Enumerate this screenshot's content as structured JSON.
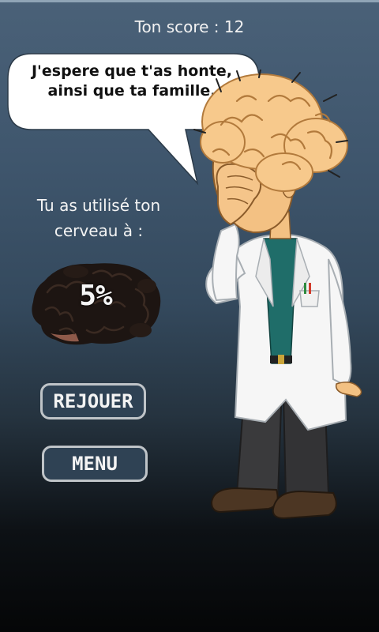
{
  "game": {
    "score_text": "Ton score : 12",
    "speech_line1": "J'espere que t'as honte,",
    "speech_line2": "ainsi que ta famille.",
    "usage_line1": "Tu as utilisé ton",
    "usage_line2": "cerveau à :",
    "brain_percent": "5%"
  },
  "buttons": {
    "replay_label": "REJOUER",
    "menu_label": "MENU"
  }
}
